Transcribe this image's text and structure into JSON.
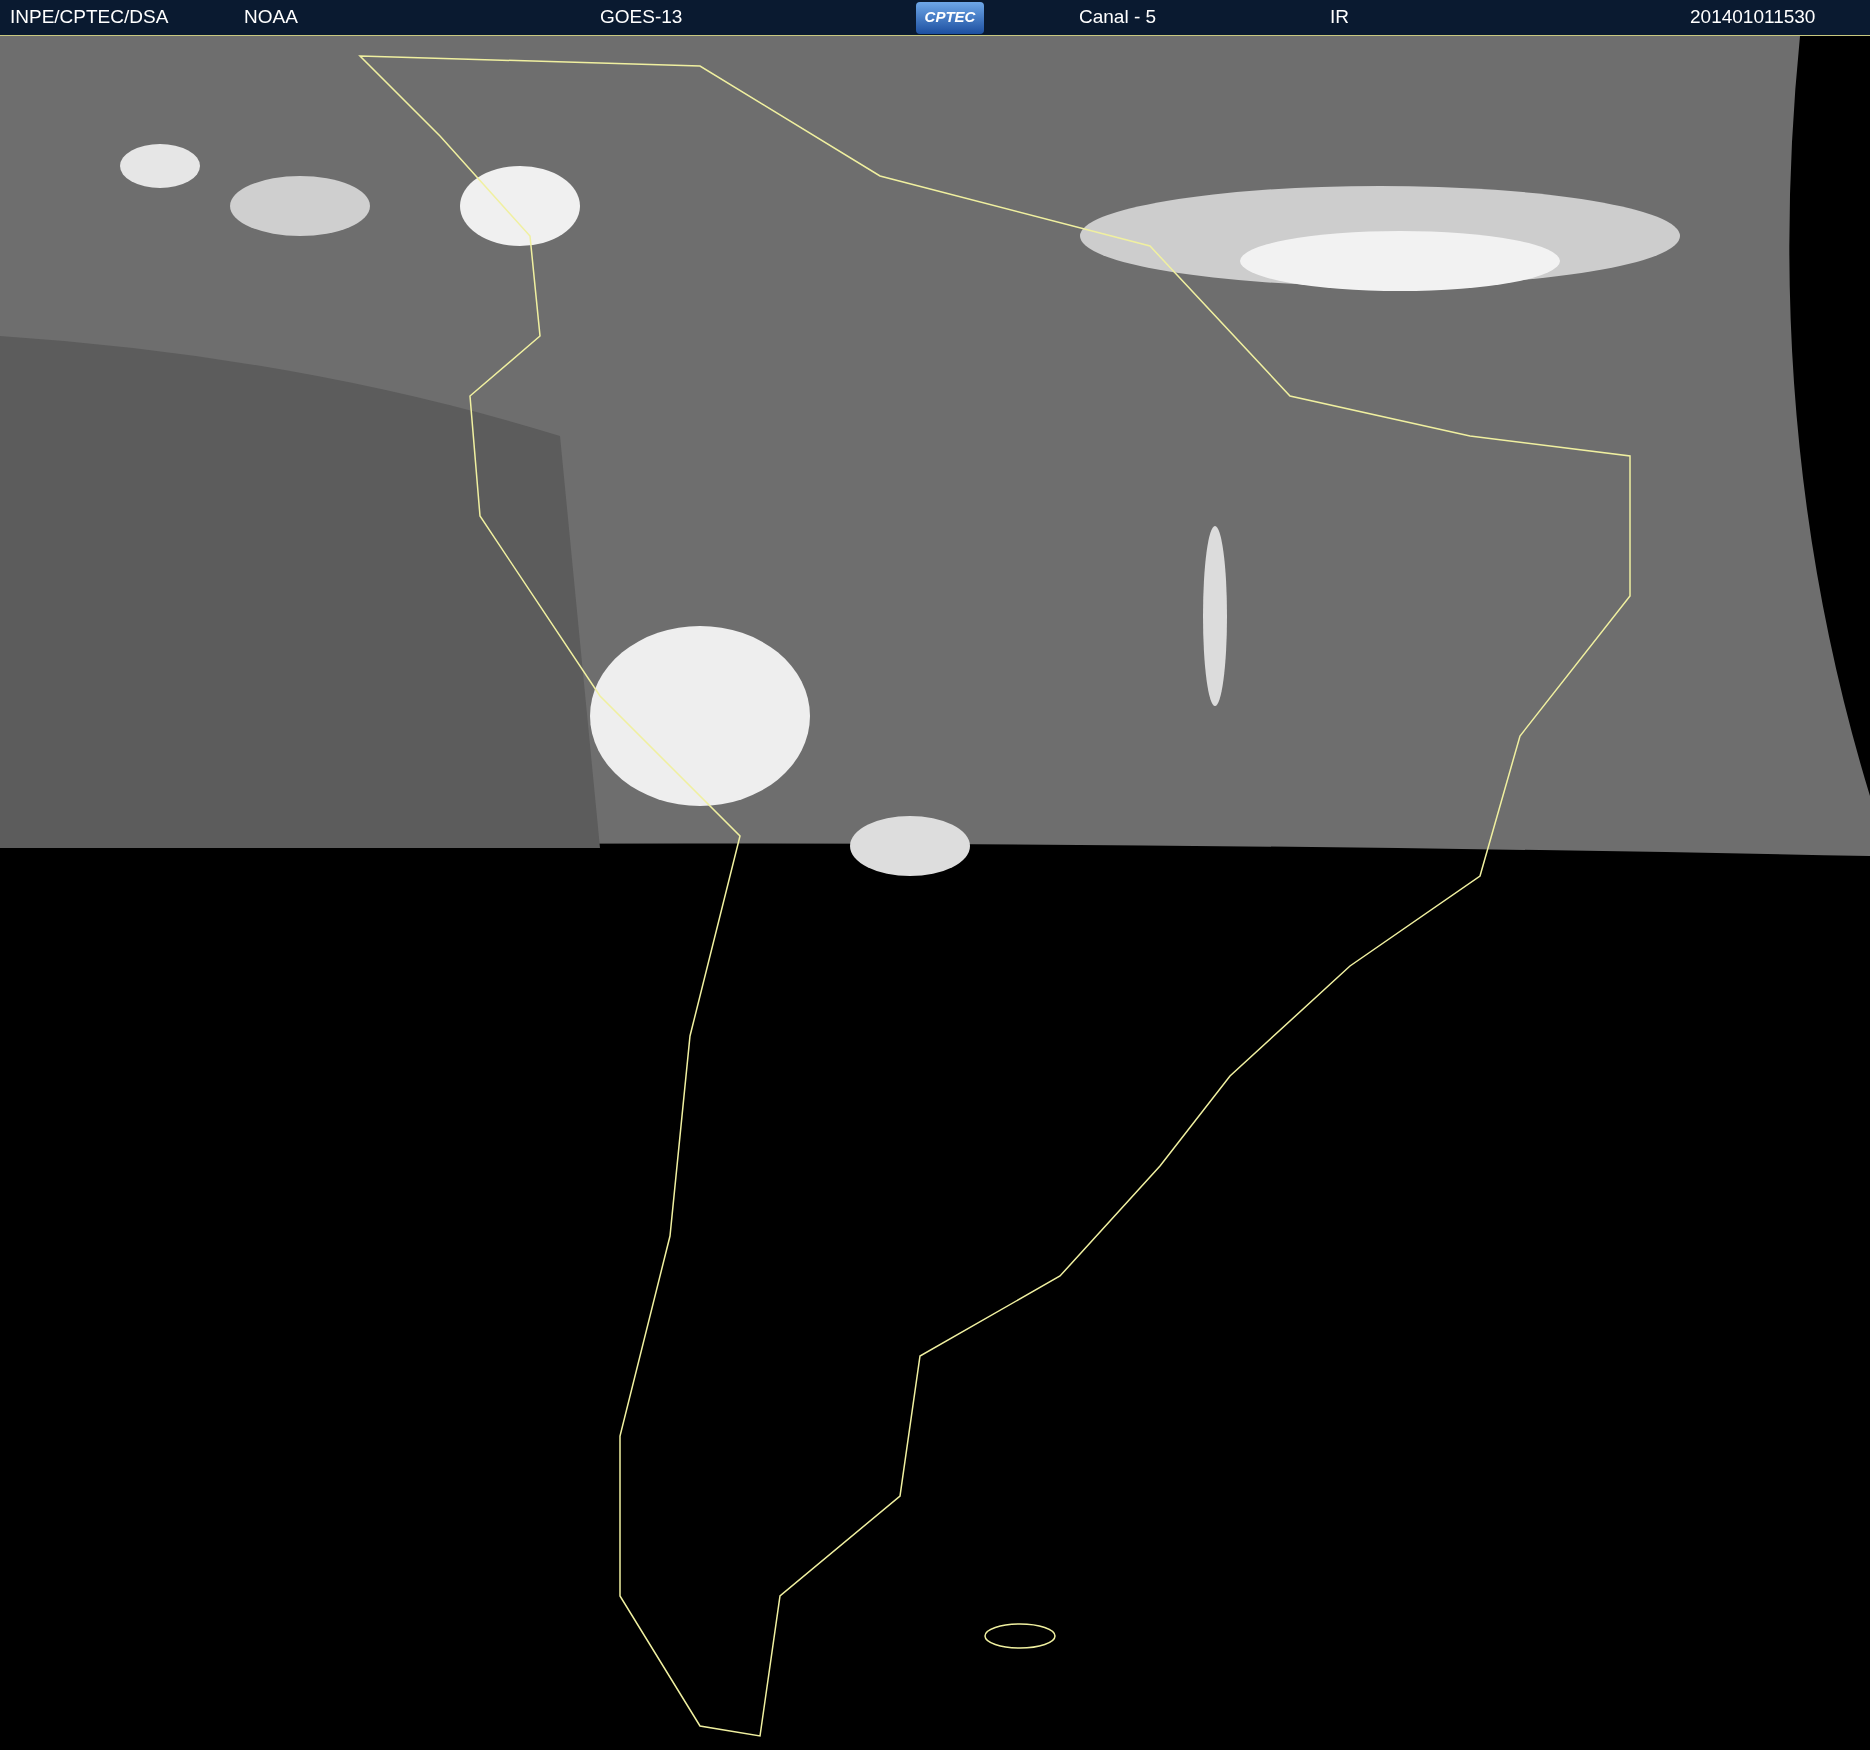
{
  "header": {
    "items": [
      {
        "kind": "text",
        "text": "INPE/CPTEC/DSA"
      },
      {
        "kind": "text",
        "text": "NOAA"
      },
      {
        "kind": "text",
        "text": "GOES-13"
      },
      {
        "kind": "logo",
        "text": "CPTEC"
      },
      {
        "kind": "text",
        "text": "Canal - 5"
      },
      {
        "kind": "text",
        "text": "IR"
      },
      {
        "kind": "text",
        "text": "201401011530"
      }
    ]
  }
}
